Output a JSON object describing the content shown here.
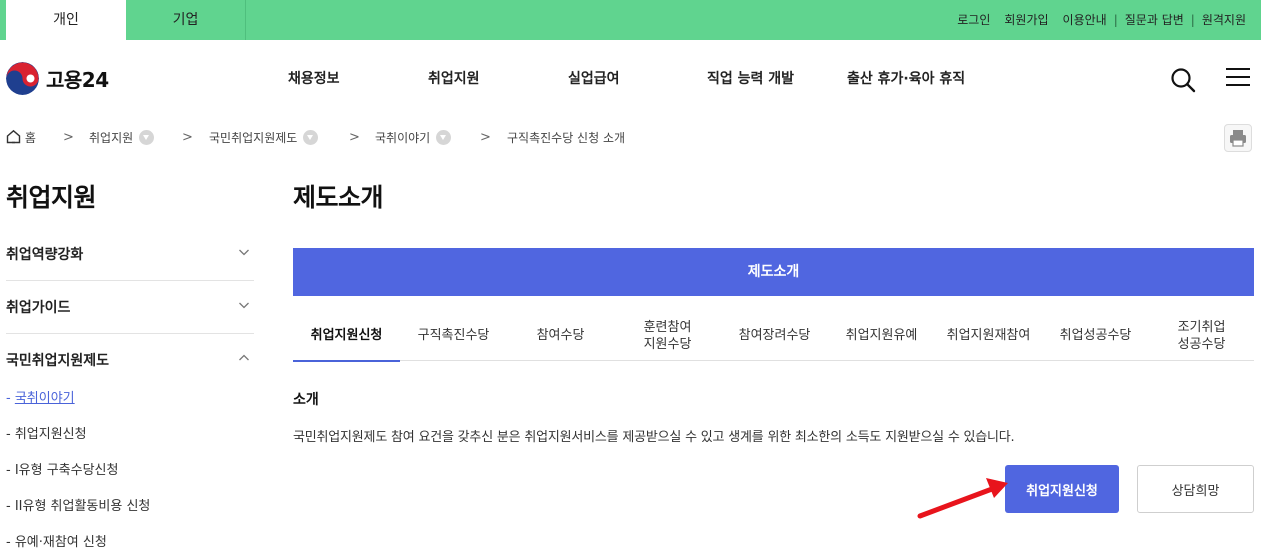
{
  "topbar": {
    "tabs": [
      "개인",
      "기업"
    ],
    "util_links": [
      "로그인",
      "회원가입",
      "이용안내",
      "질문과 답변",
      "원격지원"
    ]
  },
  "header": {
    "logo_text": "고용24",
    "nav": [
      "채용정보",
      "취업지원",
      "실업급여",
      "직업 능력 개발",
      "출산 휴가·육아 휴직"
    ]
  },
  "breadcrumb": {
    "home": "홈",
    "items": [
      "취업지원",
      "국민취업지원제도",
      "국취이야기",
      "구직촉진수당 신청 소개"
    ]
  },
  "sidebar": {
    "title": "취업지원",
    "groups": [
      "취업역량강화",
      "취업가이드",
      "국민취업지원제도"
    ],
    "sub_items": [
      "국취이야기",
      "취업지원신청",
      "I유형 구축수당신청",
      "II유형 취업활동비용 신청",
      "유예·재참여 신청"
    ]
  },
  "main": {
    "title": "제도소개",
    "banner": "제도소개",
    "tabs": [
      {
        "label": "취업지원신청"
      },
      {
        "label": "구직촉진수당"
      },
      {
        "label": "참여수당"
      },
      {
        "label": "훈련참여\n지원수당"
      },
      {
        "label": "참여장려수당"
      },
      {
        "label": "취업지원유예"
      },
      {
        "label": "취업지원재참여"
      },
      {
        "label": "취업성공수당"
      },
      {
        "label": "조기취업\n성공수당"
      }
    ],
    "section_title": "소개",
    "section_desc": "국민취업지원제도 참여 요건을 갖추신 분은 취업지원서비스를 제공받으실 수 있고 생계를 위한 최소한의 소득도 지원받으실 수 있습니다.",
    "apply_button": "취업지원신청",
    "consult_button": "상담희망"
  },
  "colors": {
    "topbar_green": "#60d48f",
    "accent_blue": "#5066e0",
    "annotation_red": "#e8141c"
  }
}
